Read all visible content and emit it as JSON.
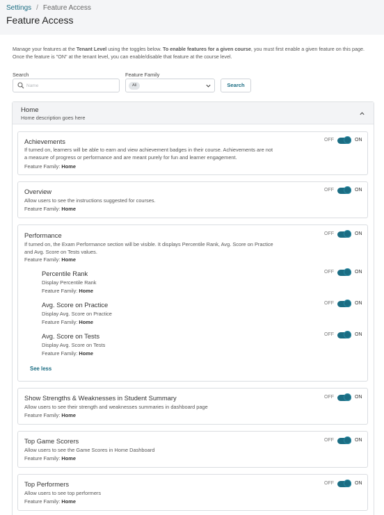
{
  "breadcrumb": {
    "parent": "Settings",
    "separator": "/",
    "current": "Feature Access"
  },
  "page_title": "Feature Access",
  "intro": {
    "p1": "Manage your features at the ",
    "b1": "Tenant Level",
    "p2": " using the toggles below. ",
    "b2": "To enable features for a given course",
    "p3": ", you must first enable a given feature on this page. Once the feature is \"ON\" at the tenant level, you can enable/disable that feature at the course level."
  },
  "filters": {
    "search_label": "Search",
    "search_placeholder": "Name",
    "search_value": "",
    "family_label": "Feature Family",
    "family_selected": "All",
    "search_button": "Search"
  },
  "toggle_labels": {
    "off": "OFF",
    "on": "ON"
  },
  "family_prefix": "Feature Family:",
  "section": {
    "title": "Home",
    "description": "Home description goes here"
  },
  "features": [
    {
      "title": "Achievements",
      "description": "If turned on, learners will be able to earn and view achievement badges in their course. Achievements are not a measure of progress or performance and are meant purely for fun and learner engagement.",
      "family": "Home",
      "enabled": true
    },
    {
      "title": "Overview",
      "description": "Allow users to see the instructions suggested for courses.",
      "family": "Home",
      "enabled": true
    },
    {
      "title": "Performance",
      "description": "If turned on, the Exam Performance section will be visible. It displays Percentile Rank, Avg. Score on Practice and Avg. Score on Tests values.",
      "family": "Home",
      "enabled": true,
      "sub_features": [
        {
          "title": "Percentile Rank",
          "description": "Display Percentile Rank",
          "family": "Home",
          "enabled": true
        },
        {
          "title": "Avg. Score on Practice",
          "description": "Display Avg. Score on Practice",
          "family": "Home",
          "enabled": true
        },
        {
          "title": "Avg. Score on Tests",
          "description": "Display Avg. Score on Tests",
          "family": "Home",
          "enabled": true
        }
      ],
      "see_less": "See less"
    },
    {
      "title": "Show Strengths & Weaknesses in Student Summary",
      "description": "Allow users to see their strength and weaknesses summaries in dashboard page",
      "family": "Home",
      "enabled": true
    },
    {
      "title": "Top Game Scorers",
      "description": "Allow users to see the Game Scores in Home Dashboard",
      "family": "Home",
      "enabled": true
    },
    {
      "title": "Top Performers",
      "description": "Allow users to see top performers",
      "family": "Home",
      "enabled": true
    }
  ],
  "colors": {
    "accent": "#1b6d83",
    "header_bg": "#f4f5f7",
    "border": "#dadde1"
  },
  "icons": {
    "search": "search-icon",
    "dropdown": "chevron-down-icon",
    "collapse": "chevron-up-icon"
  }
}
